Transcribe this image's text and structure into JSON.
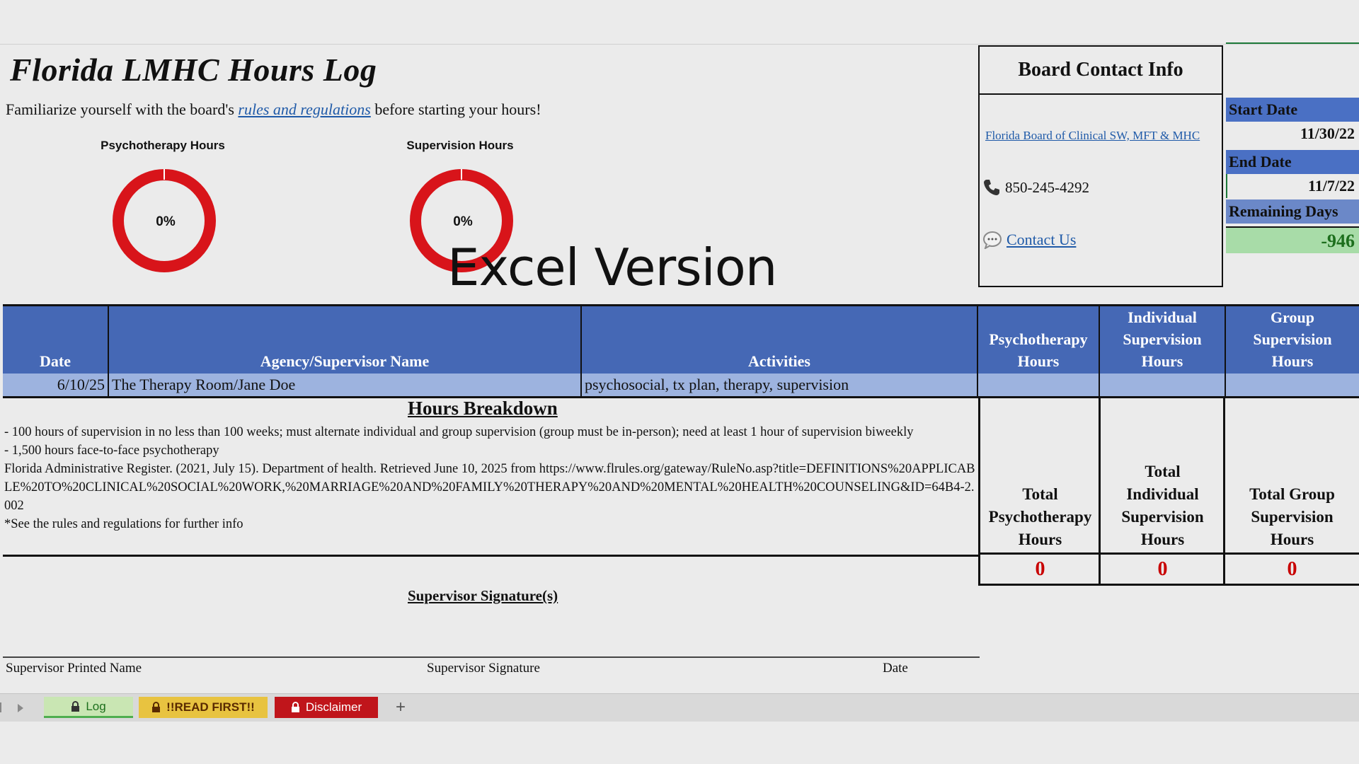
{
  "title": "Florida LMHC Hours Log",
  "intro": {
    "before": "Familiarize yourself with the board's ",
    "link": "rules and regulations",
    "after": " before starting your hours!"
  },
  "gauges": [
    {
      "title": "Psychotherapy Hours",
      "value_label": "0%",
      "progress": 0
    },
    {
      "title": "Supervision Hours",
      "value_label": "0%",
      "progress": 0
    }
  ],
  "watermark": "Excel Version",
  "contact": {
    "heading": "Board Contact Info",
    "link": "Florida Board of Clinical SW, MFT & MHC",
    "phone": "850-245-4292",
    "contact_us": "Contact Us"
  },
  "dates": {
    "start_label": "Start Date",
    "start_value": "11/30/22",
    "end_label": "End Date",
    "end_value": "11/7/22",
    "remaining_label": "Remaining Days",
    "remaining_value": "-946"
  },
  "table": {
    "headers": [
      "Date",
      "Agency/Supervisor Name",
      "Activities",
      "Psychotherapy Hours",
      "Individual Supervision Hours",
      "Group Supervision Hours"
    ],
    "rows": [
      {
        "date": "6/10/25",
        "agency": "The Therapy Room/Jane Doe",
        "activities": "psychosocial, tx plan, therapy, supervision",
        "psych": "",
        "indiv": "",
        "group": ""
      }
    ]
  },
  "breakdown": {
    "title": "Hours Breakdown",
    "lines": [
      "- 100 hours of supervision in no less than 100 weeks; must alternate individual and group supervision (group must be in-person); need at least 1 hour of supervision biweekly",
      "- 1,500 hours face-to-face psychotherapy",
      "Florida Administrative Register. (2021, July 15). Department of health. Retrieved June 10, 2025 from https://www.flrules.org/gateway/RuleNo.asp?title=DEFINITIONS%20APPLICABLE%20TO%20CLINICAL%20SOCIAL%20WORK,%20MARRIAGE%20AND%20FAMILY%20THERAPY%20AND%20MENTAL%20HEALTH%20COUNSELING&ID=64B4-2.002",
      "*See the rules and regulations for further info"
    ]
  },
  "totals": [
    {
      "label": "Total Psychotherapy Hours",
      "value": "0"
    },
    {
      "label": "Total Individual Supervision Hours",
      "value": "0"
    },
    {
      "label": "Total Group Supervision Hours",
      "value": "0"
    }
  ],
  "signature": {
    "title": "Supervisor Signature(s)",
    "printed_name": "Supervisor Printed Name",
    "signature": "Supervisor Signature",
    "date": "Date"
  },
  "tabs": [
    {
      "label": "Log",
      "color": "#c9e6b3",
      "text_color": "#1d6f1d",
      "icon": "lock-icon"
    },
    {
      "label": "!!READ FIRST!!",
      "color": "#e8c340",
      "text_color": "#5a2a00",
      "icon": "lock-icon"
    },
    {
      "label": "Disclaimer",
      "color": "#c0151b",
      "text_color": "#ffffff",
      "icon": "lock-icon"
    }
  ],
  "add_tab": "+",
  "colors": {
    "header_blue": "#4568b5",
    "row_blue": "#9db3df",
    "gauge_red": "#d8141a",
    "remaining_green": "#a8dca8"
  }
}
